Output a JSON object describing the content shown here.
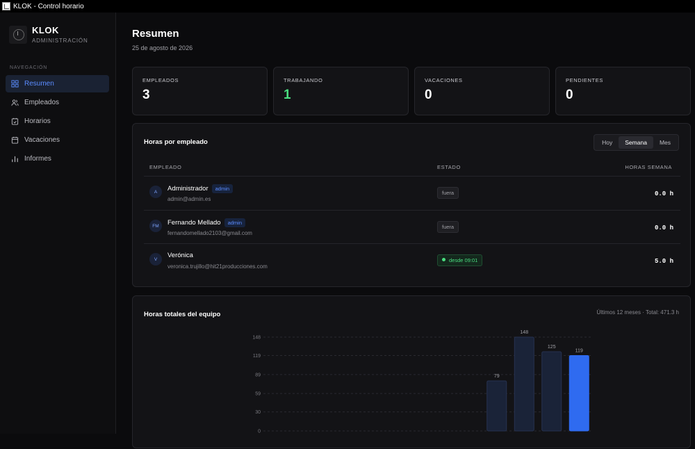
{
  "window": {
    "title": "KLOK - Control horario"
  },
  "brand": {
    "name": "KLOK",
    "subtitle": "ADMINISTRACIÓN"
  },
  "nav": {
    "label": "NAVEGACIÓN",
    "items": [
      {
        "label": "Resumen",
        "icon": "grid-icon",
        "active": true
      },
      {
        "label": "Empleados",
        "icon": "users-icon"
      },
      {
        "label": "Horarios",
        "icon": "calendar-check-icon"
      },
      {
        "label": "Vacaciones",
        "icon": "calendar-icon"
      },
      {
        "label": "Informes",
        "icon": "bar-chart-icon"
      }
    ]
  },
  "page": {
    "title": "Resumen",
    "date": "25 de agosto de 2026"
  },
  "stats": [
    {
      "label": "EMPLEADOS",
      "value": "3"
    },
    {
      "label": "TRABAJANDO",
      "value": "1",
      "color": "#4ade80"
    },
    {
      "label": "VACACIONES",
      "value": "0"
    },
    {
      "label": "PENDIENTES",
      "value": "0"
    }
  ],
  "hours_card": {
    "title": "Horas por empleado",
    "tabs": [
      "Hoy",
      "Semana",
      "Mes"
    ],
    "active_tab": "Semana",
    "columns": [
      "EMPLEADO",
      "ESTADO",
      "HORAS SEMANA"
    ],
    "rows": [
      {
        "initials": "A",
        "name": "Administrador",
        "role": "admin",
        "email": "admin@admin.es",
        "state": "fuera",
        "working": false,
        "hours": "0.0 h"
      },
      {
        "initials": "FM",
        "name": "Fernando Mellado",
        "role": "admin",
        "email": "fernandomellado2103@gmail.com",
        "state": "fuera",
        "working": false,
        "hours": "0.0 h"
      },
      {
        "initials": "V",
        "name": "Verónica",
        "role": "",
        "email": "veronica.trujillo@hit21producciones.com",
        "state": "desde 09:01",
        "working": true,
        "hours": "5.0 h"
      }
    ]
  },
  "team_card": {
    "title": "Horas totales del equipo",
    "meta": "Últimos 12 meses · Total: 471.3 h"
  },
  "chart_data": {
    "type": "bar",
    "y_ticks": [
      0,
      30,
      59,
      89,
      119,
      148
    ],
    "ylim": [
      0,
      148
    ],
    "values": [
      0,
      0,
      0,
      0,
      0,
      0,
      0,
      0,
      79,
      148,
      125,
      119
    ],
    "value_labels": [
      "",
      "",
      "",
      "",
      "",
      "",
      "",
      "",
      "79",
      "148",
      "125",
      "119"
    ],
    "highlight_index": 11,
    "colors": {
      "bar": "#1a2338",
      "bar_border": "#263250",
      "highlight": "#2f6bf0",
      "grid": "#2a2a30"
    }
  }
}
